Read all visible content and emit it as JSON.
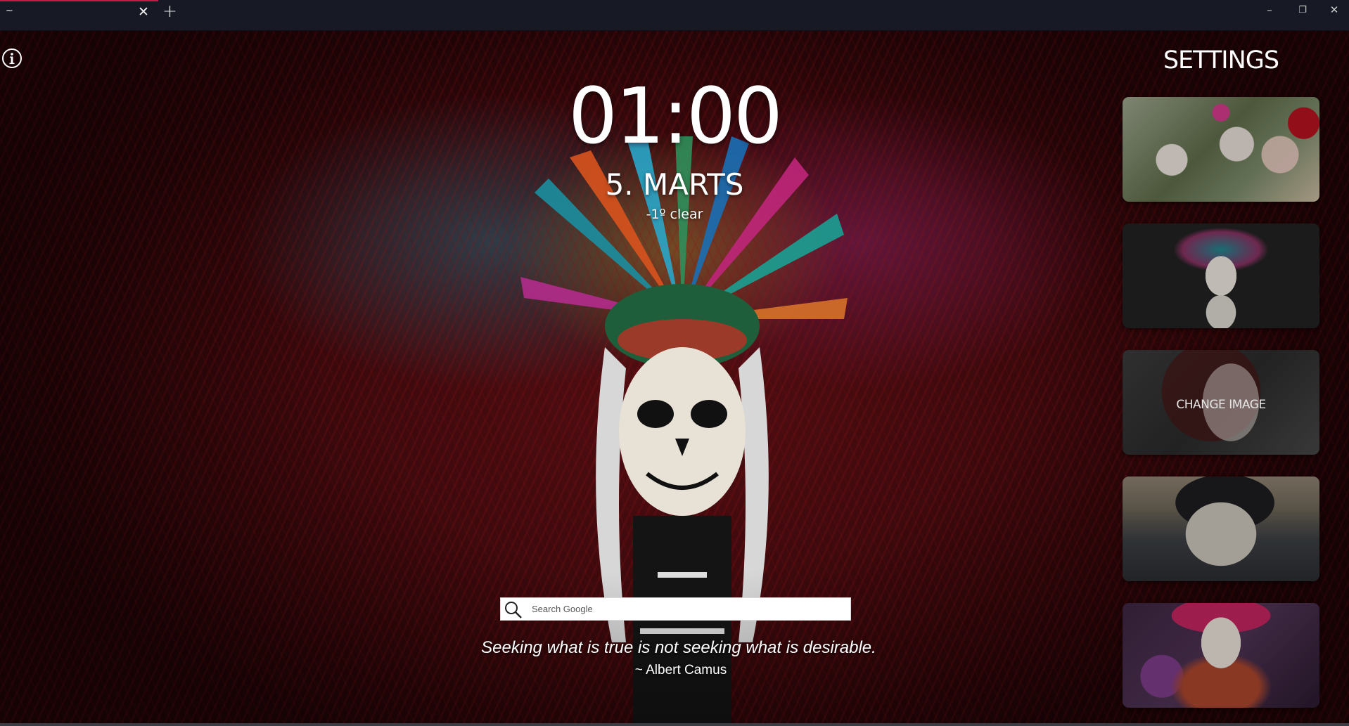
{
  "tab": {
    "title": "~",
    "close_icon": "close-icon",
    "accent_color": "#c41d4a"
  },
  "window_controls": {
    "minimize_glyph": "–",
    "restore_glyph": "❐",
    "close_glyph": "✕"
  },
  "new_tab_glyph": "+",
  "close_glyph": "✕",
  "info_icon": "info-icon",
  "clock": {
    "time": "01:00",
    "date": "5. MARTS",
    "weather": "-1º clear"
  },
  "search": {
    "placeholder": "Search Google",
    "icon": "search-icon"
  },
  "quote": {
    "text": "Seeking what is true is not seeking what is desirable.",
    "author": "~ Albert Camus"
  },
  "settings": {
    "title": "SETTINGS",
    "thumbnails": [
      {
        "label": ""
      },
      {
        "label": ""
      },
      {
        "label": "CHANGE IMAGE"
      },
      {
        "label": ""
      },
      {
        "label": ""
      }
    ]
  }
}
